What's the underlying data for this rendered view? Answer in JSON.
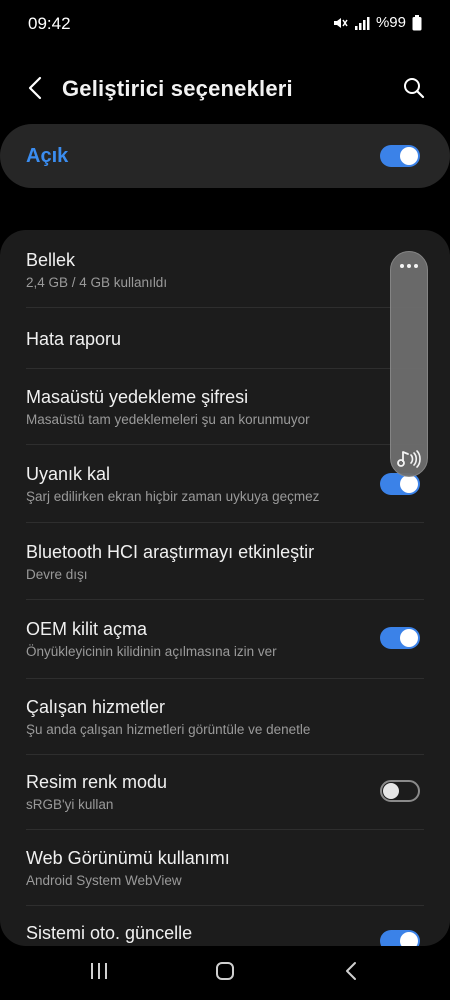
{
  "status_bar": {
    "time": "09:42",
    "battery_text": "%99"
  },
  "header": {
    "title": "Geliştirici seçenekleri"
  },
  "master_switch": {
    "label": "Açık",
    "state": "on"
  },
  "items": [
    {
      "title": "Bellek",
      "subtitle": "2,4 GB / 4 GB kullanıldı"
    },
    {
      "title": "Hata raporu",
      "subtitle": ""
    },
    {
      "title": "Masaüstü yedekleme şifresi",
      "subtitle": "Masaüstü tam yedeklemeleri şu an korunmuyor"
    },
    {
      "title": "Uyanık kal",
      "subtitle": "Şarj edilirken ekran hiçbir zaman uykuya geçmez",
      "toggle": "on"
    },
    {
      "title": "Bluetooth HCI araştırmayı etkinleştir",
      "subtitle": "Devre dışı"
    },
    {
      "title": "OEM kilit açma",
      "subtitle": "Önyükleyicinin kilidinin açılmasına izin ver",
      "toggle": "on"
    },
    {
      "title": "Çalışan hizmetler",
      "subtitle": "Şu anda çalışan hizmetleri görüntüle ve denetle"
    },
    {
      "title": "Resim renk modu",
      "subtitle": "sRGB'yi kullan",
      "toggle": "off"
    },
    {
      "title": "Web Görünümü kullanımı",
      "subtitle": "Android System WebView"
    },
    {
      "title": "Sistemi oto. güncelle",
      "subtitle": "",
      "toggle": "on"
    }
  ],
  "colors": {
    "accent": "#3b82e8",
    "background": "#000000",
    "card": "#1c1c1c",
    "master_card": "#262626"
  },
  "icons": {
    "back": "arrow-left-icon",
    "search": "search-icon",
    "mute": "mute-icon",
    "signal": "signal-icon",
    "battery": "battery-icon",
    "float_menu": "more-dots-icon",
    "float_sound": "music-note-icon",
    "nav_recents": "recents-icon",
    "nav_home": "home-icon",
    "nav_back": "nav-back-icon"
  }
}
